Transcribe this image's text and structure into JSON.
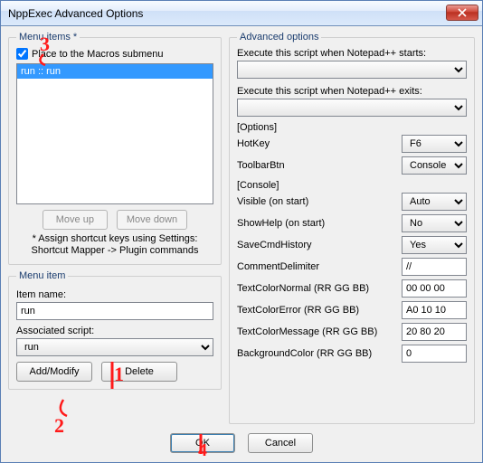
{
  "window": {
    "title": "NppExec Advanced Options"
  },
  "menu_items_group": {
    "legend": "Menu items *",
    "checkbox_label": "Place to the Macros submenu",
    "checkbox_checked": true,
    "list": [
      "run :: run"
    ],
    "move_up": "Move up",
    "move_down": "Move down",
    "footnote1": "* Assign shortcut keys using Settings:",
    "footnote2": "Shortcut Mapper -> Plugin commands"
  },
  "menu_item_group": {
    "legend": "Menu item",
    "item_name_label": "Item name:",
    "item_name_value": "run",
    "assoc_label": "Associated script:",
    "assoc_value": "run",
    "add_modify": "Add/Modify",
    "delete": "Delete"
  },
  "advanced_group": {
    "legend": "Advanced options",
    "exec_start_label": "Execute this script when Notepad++ starts:",
    "exec_start_value": "",
    "exec_exit_label": "Execute this script when Notepad++ exits:",
    "exec_exit_value": "",
    "options_heading": "[Options]",
    "hotkey_label": "HotKey",
    "hotkey_value": "F6",
    "toolbarbtn_label": "ToolbarBtn",
    "toolbarbtn_value": "Console",
    "console_heading": "[Console]",
    "visible_label": "Visible (on start)",
    "visible_value": "Auto",
    "showhelp_label": "ShowHelp (on start)",
    "showhelp_value": "No",
    "savecmd_label": "SaveCmdHistory",
    "savecmd_value": "Yes",
    "commentdelim_label": "CommentDelimiter",
    "commentdelim_value": "//",
    "tc_normal_label": "TextColorNormal (RR GG BB)",
    "tc_normal_value": "00 00 00",
    "tc_error_label": "TextColorError (RR GG BB)",
    "tc_error_value": "A0 10 10",
    "tc_msg_label": "TextColorMessage (RR GG BB)",
    "tc_msg_value": "20 80 20",
    "bgcolor_label": "BackgroundColor (RR GG BB)",
    "bgcolor_value": "0"
  },
  "buttons": {
    "ok": "OK",
    "cancel": "Cancel"
  },
  "annotations": {
    "a1": "1",
    "a2": "2",
    "a3": "3",
    "a4": "4"
  }
}
